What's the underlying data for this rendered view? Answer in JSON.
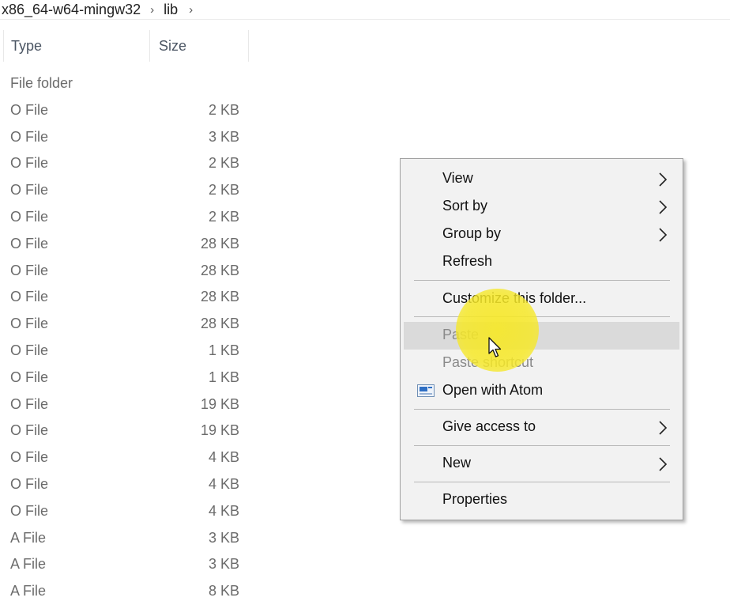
{
  "breadcrumb": {
    "items": [
      "x86_64-w64-mingw32",
      "lib"
    ],
    "separator": "›"
  },
  "columns": {
    "type": "Type",
    "size": "Size"
  },
  "rows": [
    {
      "type": "File folder",
      "size": ""
    },
    {
      "type": "O File",
      "size": "2 KB"
    },
    {
      "type": "O File",
      "size": "3 KB"
    },
    {
      "type": "O File",
      "size": "2 KB"
    },
    {
      "type": "O File",
      "size": "2 KB"
    },
    {
      "type": "O File",
      "size": "2 KB"
    },
    {
      "type": "O File",
      "size": "28 KB"
    },
    {
      "type": "O File",
      "size": "28 KB"
    },
    {
      "type": "O File",
      "size": "28 KB"
    },
    {
      "type": "O File",
      "size": "28 KB"
    },
    {
      "type": "O File",
      "size": "1 KB"
    },
    {
      "type": "O File",
      "size": "1 KB"
    },
    {
      "type": "O File",
      "size": "19 KB"
    },
    {
      "type": "O File",
      "size": "19 KB"
    },
    {
      "type": "O File",
      "size": "4 KB"
    },
    {
      "type": "O File",
      "size": "4 KB"
    },
    {
      "type": "O File",
      "size": "4 KB"
    },
    {
      "type": "A File",
      "size": "3 KB"
    },
    {
      "type": "A File",
      "size": "3 KB"
    },
    {
      "type": "A File",
      "size": "8 KB"
    }
  ],
  "context_menu": {
    "view": "View",
    "sort_by": "Sort by",
    "group_by": "Group by",
    "refresh": "Refresh",
    "customize": "Customize this folder...",
    "paste": "Paste",
    "paste_shortcut": "Paste shortcut",
    "open_with_atom": "Open with Atom",
    "give_access": "Give access to",
    "new": "New",
    "properties": "Properties"
  },
  "colors": {
    "menu_background": "#f2f2f2",
    "menu_hover": "#dadada",
    "highlight_spot": "#f6e828",
    "secondary_text": "#6b6b6b"
  },
  "icons": {
    "submenu": "chevron-right-icon",
    "breadcrumb": "chevron-right-icon",
    "atom": "atom-app-icon",
    "cursor": "mouse-pointer-icon"
  }
}
